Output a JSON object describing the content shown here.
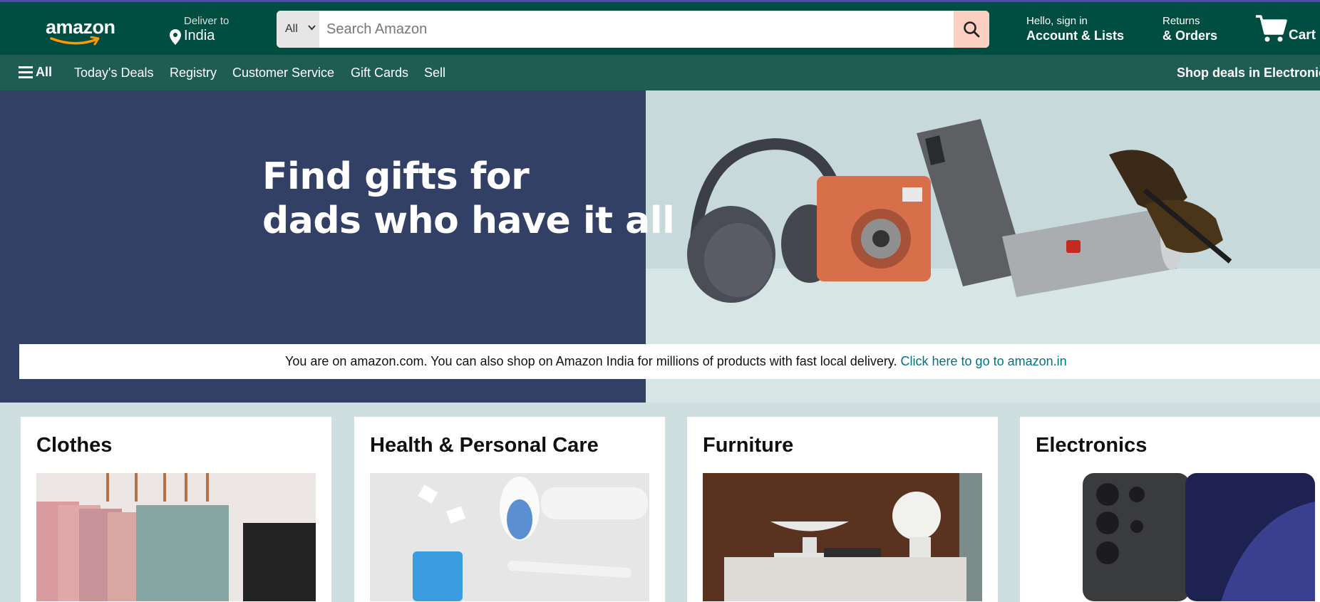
{
  "header": {
    "logo_text": "amazon",
    "deliver_label": "Deliver to",
    "deliver_location": "India",
    "search_category": "All",
    "search_placeholder": "Search Amazon",
    "account_greeting": "Hello, sign in",
    "account_label": "Account & Lists",
    "returns_label": "Returns",
    "orders_label": "& Orders",
    "cart_label": "Cart",
    "icons": [
      "location-pin-icon",
      "search-icon",
      "cart-icon",
      "chevron-down-icon"
    ]
  },
  "nav": {
    "all_label": "All",
    "items": [
      "Today's Deals",
      "Registry",
      "Customer Service",
      "Gift Cards",
      "Sell"
    ],
    "promo": "Shop deals in Electronics"
  },
  "hero": {
    "headline_line1": "Find gifts for",
    "headline_line2": "dads who have it all"
  },
  "notice": {
    "text": "You are on amazon.com. You can also shop on Amazon India for millions of products with fast local delivery.",
    "link": "Click here to go to amazon.in"
  },
  "cards": [
    {
      "title": "Clothes"
    },
    {
      "title": "Health & Personal Care"
    },
    {
      "title": "Furniture"
    },
    {
      "title": "Electronics"
    }
  ],
  "colors": {
    "header_bg": "#004e42",
    "nav_bg": "#1e5c54",
    "search_button": "#fbcfc2",
    "hero_left": "#324066",
    "link": "#007185"
  }
}
